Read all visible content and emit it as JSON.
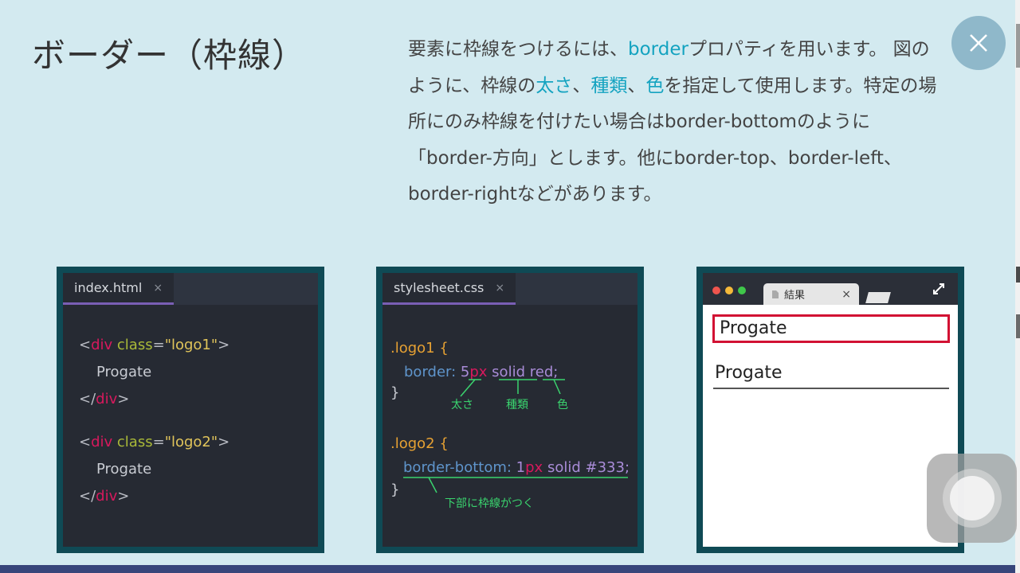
{
  "header": {
    "title": "ボーダー（枠線）",
    "description": [
      {
        "text": "要素に枠線をつけるには、",
        "kw": false
      },
      {
        "text": "border",
        "kw": true
      },
      {
        "text": "プロパティを用います。 図のように、枠線の",
        "kw": false
      },
      {
        "text": "太さ",
        "kw": true
      },
      {
        "text": "、",
        "kw": false
      },
      {
        "text": "種類",
        "kw": true
      },
      {
        "text": "、",
        "kw": false
      },
      {
        "text": "色",
        "kw": true
      },
      {
        "text": "を指定して使用します。特定の場所にのみ枠線を付けたい場合はborder-bottomのように「border-方向」とします。他にborder-top、border-left、border-rightなどがあります。",
        "kw": false
      }
    ],
    "accent_color": "#14a3c0"
  },
  "html_panel": {
    "tab_label": "index.html",
    "tab_close": "×",
    "lines": [
      {
        "open": "<",
        "tag": "div",
        "attr": " class",
        "eq": "=",
        "str": "\"logo1\"",
        "close": ">"
      },
      {
        "text": "Progate"
      },
      {
        "end_open": "</",
        "tag": "div",
        "close": ">"
      },
      {
        "open": "<",
        "tag": "div",
        "attr": " class",
        "eq": "=",
        "str": "\"logo2\"",
        "close": ">"
      },
      {
        "text": "Progate"
      },
      {
        "end_open": "</",
        "tag": "div",
        "close": ">"
      }
    ]
  },
  "css_panel": {
    "tab_label": "stylesheet.css",
    "tab_close": "×",
    "rule1_selector": ".logo1 {",
    "rule1_prop": "border:",
    "rule1_num": "5",
    "rule1_unit": "px",
    "rule1_style": "solid",
    "rule1_color": "red;",
    "rule1_close": "}",
    "anno_width": "太さ",
    "anno_type": "種類",
    "anno_color": "色",
    "rule2_selector": ".logo2 {",
    "rule2_prop": "border-bottom:",
    "rule2_num": "1",
    "rule2_unit": "px",
    "rule2_style": "solid",
    "rule2_color": "#333;",
    "rule2_close": "}",
    "anno_bottom": "下部に枠線がつく"
  },
  "result_panel": {
    "tab_label": "結果",
    "tab_close": "×",
    "item1": "Progate",
    "item2": "Progate"
  },
  "close_button_icon": "close-icon",
  "assistive_touch_icon": "assistive-touch-icon"
}
